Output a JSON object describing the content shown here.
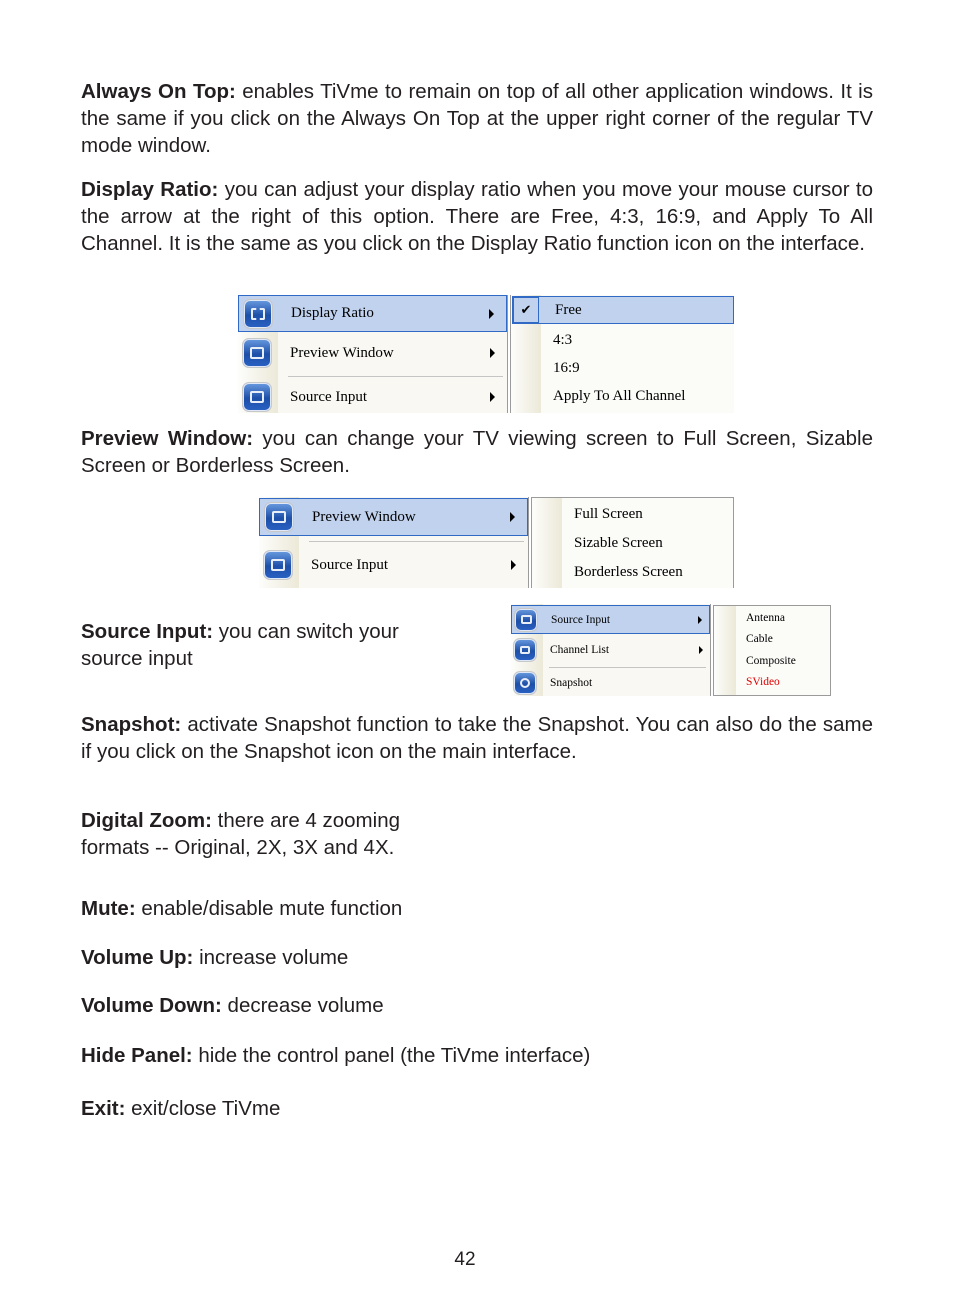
{
  "sections": {
    "always_on_top": {
      "term": "Always On Top:",
      "text": " enables TiVme to remain on top of all other application windows. It is the same if you click on the Always On Top at the upper right corner of the regular TV mode window."
    },
    "display_ratio": {
      "term": "Display Ratio:",
      "text": " you can adjust your display ratio when you move your mouse cursor to the arrow at the right of this option. There are Free, 4:3, 16:9, and Apply To All Channel. It is the same as you click on the Display Ratio function icon on the interface."
    },
    "preview_window": {
      "term": "Preview Window:",
      "text": " you can change your TV viewing screen to Full Screen, Sizable Screen or Borderless Screen."
    },
    "source_input": {
      "term": "Source Input:",
      "text": " you can switch your source input"
    },
    "snapshot": {
      "term": "Snapshot:",
      "text": " activate Snapshot function to take the Snapshot. You can also do the same if you click on the Snapshot icon on the main interface."
    },
    "digital_zoom": {
      "term": "Digital Zoom:",
      "text": " there are 4 zooming formats -- Original, 2X, 3X and 4X."
    },
    "mute": {
      "term": "Mute:",
      "text": " enable/disable mute function"
    },
    "volume_up": {
      "term": "Volume Up:",
      "text": " increase volume"
    },
    "volume_down": {
      "term": "Volume Down:",
      "text": " decrease volume"
    },
    "hide_panel": {
      "term": "Hide Panel:",
      "text": " hide the control panel (the TiVme interface)"
    },
    "exit": {
      "term": "Exit:",
      "text": " exit/close TiVme"
    }
  },
  "menus": {
    "display_ratio_shot": {
      "main_items": [
        {
          "label": "Display Ratio",
          "icon": "display-ratio-icon",
          "selected": true,
          "has_submenu": true
        },
        {
          "label": "Preview Window",
          "icon": "preview-window-icon",
          "selected": false,
          "has_submenu": true
        },
        {
          "label": "Source Input",
          "icon": "source-input-icon",
          "selected": false,
          "has_submenu": true
        }
      ],
      "sub_items": [
        {
          "label": "Free",
          "checked": true,
          "selected": true
        },
        {
          "label": "4:3",
          "checked": false
        },
        {
          "label": "16:9",
          "checked": false
        },
        {
          "label": "Apply To All Channel",
          "checked": false
        }
      ],
      "check_glyph": "✔"
    },
    "preview_window_shot": {
      "main_items": [
        {
          "label": "Preview Window",
          "icon": "preview-window-icon",
          "selected": true,
          "has_submenu": true
        },
        {
          "label": "Source Input",
          "icon": "source-input-icon",
          "selected": false,
          "has_submenu": true
        }
      ],
      "sub_items": [
        {
          "label": "Full Screen"
        },
        {
          "label": "Sizable Screen"
        },
        {
          "label": "Borderless Screen"
        }
      ]
    },
    "source_input_shot": {
      "main_items": [
        {
          "label": "Source Input",
          "icon": "source-input-icon",
          "selected": true,
          "has_submenu": true
        },
        {
          "label": "Channel List",
          "icon": "channel-list-icon",
          "selected": false,
          "has_submenu": true
        },
        {
          "label": "Snapshot",
          "icon": "snapshot-icon",
          "selected": false,
          "has_submenu": false
        }
      ],
      "sub_items": [
        {
          "label": "Antenna",
          "color": "#000000"
        },
        {
          "label": "Cable",
          "color": "#000000"
        },
        {
          "label": "Composite",
          "color": "#000000"
        },
        {
          "label": "SVideo",
          "color": "#e00000"
        }
      ]
    }
  },
  "colors": {
    "text": "#231f20",
    "menu_highlight": "#c1d2ee",
    "menu_highlight_border": "#316ac5",
    "active_source": "#e00000"
  },
  "page_number": "42"
}
